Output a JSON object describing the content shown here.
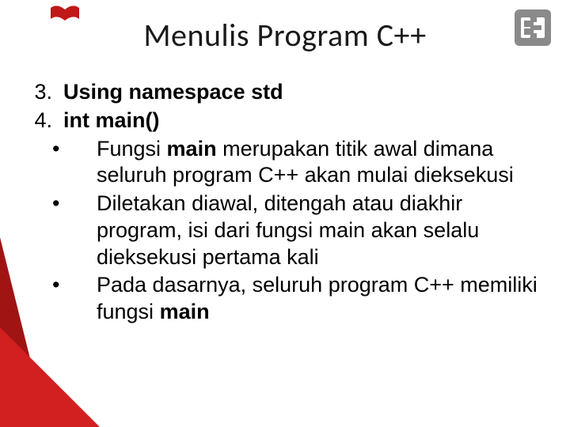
{
  "title": "Menulis Program C++",
  "items": {
    "n3": {
      "num": "3.",
      "text": "Using namespace std"
    },
    "n4": {
      "num": "4.",
      "text": "int main()"
    }
  },
  "bullets": {
    "b1": {
      "pre": "Fungsi  ",
      "kw": "main",
      "post": "  merupakan titik awal dimana seluruh  program  C++  akan  mulai dieksekusi"
    },
    "b2": "Diletakan  diawal,  ditengah  atau  diakhir program,  isi  dari  fungsi  main  akan selalu  dieksekusi  pertama  kali",
    "b3": {
      "pre": "Pada  dasarnya,  seluruh program C++ memiliki fungsi  ",
      "kw": "main"
    }
  },
  "marks": {
    "bullet": "•"
  },
  "logo": {
    "book_color": "#c01818",
    "right_bg": "#8a8a8a",
    "right_text_color": "#ffffff"
  },
  "decor": {
    "dark_red": "#a01414",
    "red": "#d21f1f"
  }
}
